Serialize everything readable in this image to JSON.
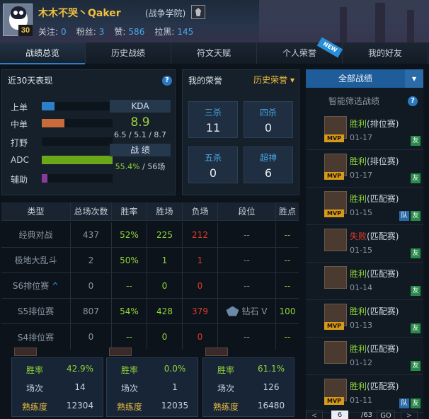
{
  "profile": {
    "name": "木木不哭丶Qaker",
    "server": "(战争学院)",
    "level": "30",
    "follow_label": "关注:",
    "follow": "0",
    "fans_label": "粉丝:",
    "fans": "3",
    "likes_label": "赞:",
    "likes": "586",
    "blacklist_label": "拉黑:",
    "blacklist": "145"
  },
  "tabs": [
    "战绩总览",
    "历史战绩",
    "符文天赋",
    "个人荣誉",
    "我的好友"
  ],
  "tab_new_badge": "NEW",
  "perf": {
    "title": "近30天表现",
    "roles": [
      {
        "label": "上单",
        "fraction": 0.18,
        "color": "#2c7fc8"
      },
      {
        "label": "中单",
        "fraction": 0.32,
        "color": "#c86a3a"
      },
      {
        "label": "打野",
        "fraction": 0.0,
        "color": "#2c7fc8"
      },
      {
        "label": "ADC",
        "fraction": 1.0,
        "color": "#6aa81a"
      },
      {
        "label": "辅助",
        "fraction": 0.08,
        "color": "#8a3a9a"
      }
    ],
    "kda_label": "KDA",
    "kda": "8.9",
    "kda_detail": "6.5 / 5.1 / 8.7",
    "record_label": "战 绩",
    "winrate": "55.4%",
    "games": "/ 56场"
  },
  "honors": {
    "title": "我的荣誉",
    "history_label": "历史荣誉",
    "items": [
      {
        "label": "三杀",
        "value": "11"
      },
      {
        "label": "四杀",
        "value": "0"
      },
      {
        "label": "五杀",
        "value": "0"
      },
      {
        "label": "超神",
        "value": "6"
      }
    ]
  },
  "table": {
    "headers": [
      "类型",
      "总场次数",
      "胜率",
      "胜场",
      "负场",
      "段位",
      "胜点"
    ],
    "rows": [
      {
        "type": "经典对战",
        "total": "437",
        "rate": "52%",
        "win": "225",
        "lose": "212",
        "rank": "--",
        "pts": "--"
      },
      {
        "type": "极地大乱斗",
        "total": "2",
        "rate": "50%",
        "win": "1",
        "lose": "1",
        "rank": "--",
        "pts": "--"
      },
      {
        "type": "S6排位赛",
        "total": "0",
        "rate": "--",
        "win": "0",
        "lose": "0",
        "rank": "--",
        "pts": "--"
      },
      {
        "type": "S5排位赛",
        "total": "807",
        "rate": "54%",
        "win": "428",
        "lose": "379",
        "rank": "钻石 V",
        "pts": "100"
      },
      {
        "type": "S4排位赛",
        "total": "0",
        "rate": "--",
        "win": "0",
        "lose": "0",
        "rank": "--",
        "pts": "--"
      }
    ]
  },
  "hero_cards": [
    {
      "rate_label": "胜率",
      "rate": "42.9%",
      "games_label": "场次",
      "games": "14",
      "mastery_label": "熟练度",
      "mastery": "12304"
    },
    {
      "rate_label": "胜率",
      "rate": "0.0%",
      "games_label": "场次",
      "games": "1",
      "mastery_label": "熟练度",
      "mastery": "12035"
    },
    {
      "rate_label": "胜率",
      "rate": "61.1%",
      "games_label": "场次",
      "games": "126",
      "mastery_label": "熟练度",
      "mastery": "16480"
    }
  ],
  "history": {
    "all_label": "全部战绩",
    "filter_label": "智能筛选战绩",
    "mvp_label": "MVP",
    "you_label": "友",
    "team_label": "队",
    "games": [
      {
        "result": "胜利",
        "mode": "(排位赛)",
        "date": "01-17",
        "win": true,
        "mvp": true,
        "team": false
      },
      {
        "result": "胜利",
        "mode": "(排位赛)",
        "date": "01-17",
        "win": true,
        "mvp": true,
        "team": false
      },
      {
        "result": "胜利",
        "mode": "(匹配赛)",
        "date": "01-15",
        "win": true,
        "mvp": true,
        "team": true
      },
      {
        "result": "失败",
        "mode": "(匹配赛)",
        "date": "01-15",
        "win": false,
        "mvp": false,
        "team": false
      },
      {
        "result": "胜利",
        "mode": "(匹配赛)",
        "date": "01-14",
        "win": true,
        "mvp": false,
        "team": false
      },
      {
        "result": "胜利",
        "mode": "(匹配赛)",
        "date": "01-13",
        "win": true,
        "mvp": true,
        "team": false
      },
      {
        "result": "胜利",
        "mode": "(匹配赛)",
        "date": "01-12",
        "win": true,
        "mvp": false,
        "team": false
      },
      {
        "result": "胜利",
        "mode": "(匹配赛)",
        "date": "01-11",
        "win": true,
        "mvp": true,
        "team": true
      }
    ]
  },
  "pager": {
    "current": "6",
    "total": "/63",
    "go": "GO"
  }
}
